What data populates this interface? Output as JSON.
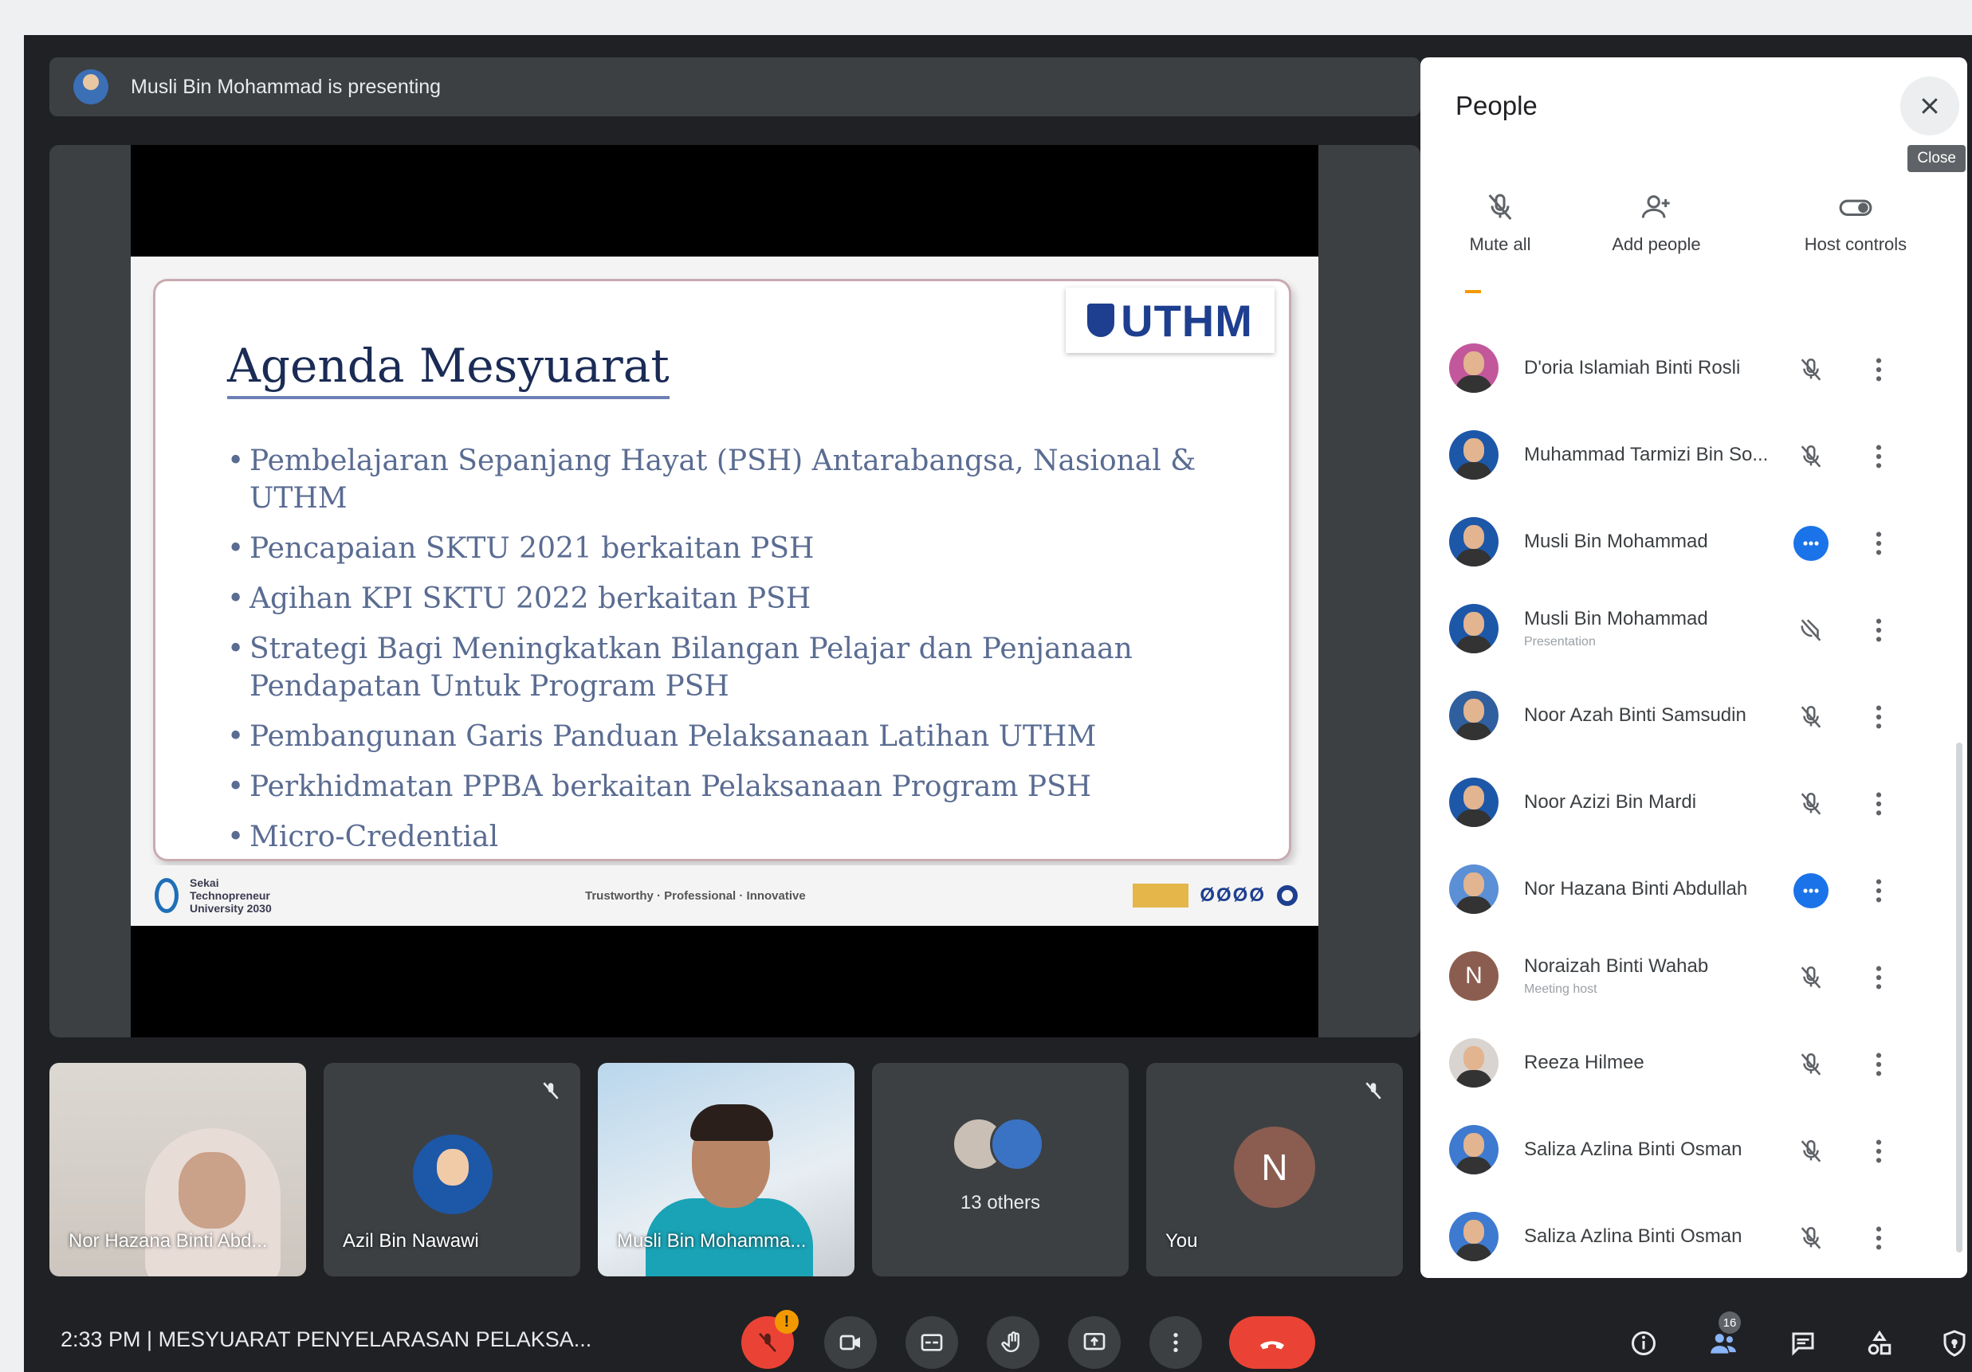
{
  "presenting_bar": {
    "text": "Musli Bin Mohammad is presenting"
  },
  "slide": {
    "logo_text": "UTHM",
    "title": "Agenda Mesyuarat",
    "agenda": [
      "Pembelajaran Sepanjang Hayat (PSH) Antarabangsa, Nasional & UTHM",
      "Pencapaian SKTU 2021 berkaitan PSH",
      "Agihan KPI SKTU 2022 berkaitan PSH",
      "Strategi Bagi Meningkatkan Bilangan Pelajar dan Penjanaan Pendapatan Untuk Program PSH",
      "Pembangunan Garis Panduan Pelaksanaan Latihan UTHM",
      "Perkhidmatan PPBA berkaitan Pelaksanaan Program PSH",
      "Micro-Credential"
    ],
    "footer_left": "Sekai Technopreneur University 2030",
    "footer_center": "Trustworthy · Professional · Innovative",
    "footer_right_dots": "ØØØØ"
  },
  "tiles": [
    {
      "name": "Nor Hazana Binti Abd..."
    },
    {
      "name": "Azil Bin Nawawi"
    },
    {
      "name": "Musli Bin Mohamma..."
    },
    {
      "name": "13 others"
    },
    {
      "name": "You",
      "initial": "N"
    }
  ],
  "bottom_bar": {
    "time_title": "2:33 PM  |  MESYUARAT PENYELARASAN PELAKSA...",
    "mic_badge": "!",
    "participant_count": "16"
  },
  "people_panel": {
    "title": "People",
    "close_tooltip": "Close",
    "controls": {
      "mute_all": "Mute all",
      "add_people": "Add people",
      "host_controls": "Host controls"
    },
    "participants": [
      {
        "name": "D'oria Islamiah Binti Rosli",
        "subtitle": "",
        "state": "muted",
        "avatar_color": "#c2589b"
      },
      {
        "name": "Muhammad Tarmizi Bin So...",
        "subtitle": "",
        "state": "muted",
        "avatar_color": "#1d57a8"
      },
      {
        "name": "Musli Bin Mohammad",
        "subtitle": "",
        "state": "speaking",
        "avatar_color": "#1d57a8"
      },
      {
        "name": "Musli Bin Mohammad",
        "subtitle": "Presentation",
        "state": "presentation",
        "avatar_color": "#1d57a8"
      },
      {
        "name": "Noor Azah Binti Samsudin",
        "subtitle": "",
        "state": "muted",
        "avatar_color": "#2f5f9e"
      },
      {
        "name": "Noor Azizi Bin Mardi",
        "subtitle": "",
        "state": "muted",
        "avatar_color": "#1d57a8"
      },
      {
        "name": "Nor Hazana Binti Abdullah",
        "subtitle": "",
        "state": "speaking",
        "avatar_color": "#5b8fd6"
      },
      {
        "name": "Noraizah Binti Wahab",
        "subtitle": "Meeting host",
        "state": "muted",
        "avatar_color": "#8b5d50",
        "initial": "N"
      },
      {
        "name": "Reeza Hilmee",
        "subtitle": "",
        "state": "muted",
        "avatar_color": "#d9d4cf"
      },
      {
        "name": "Saliza Azlina Binti Osman",
        "subtitle": "",
        "state": "muted",
        "avatar_color": "#3e7ad0"
      },
      {
        "name": "Saliza Azlina Binti Osman",
        "subtitle": "",
        "state": "muted",
        "avatar_color": "#3e7ad0"
      }
    ]
  }
}
